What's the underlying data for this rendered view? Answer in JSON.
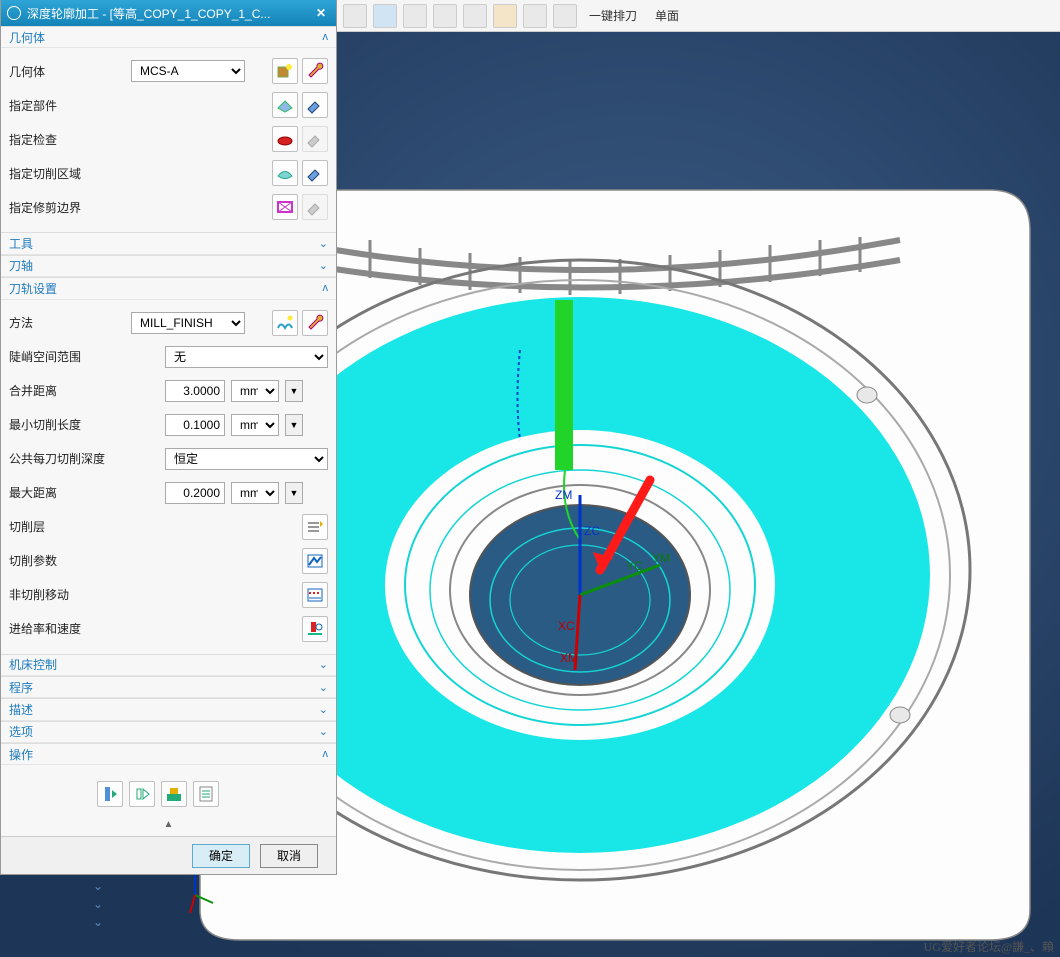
{
  "dialog": {
    "title": "深度轮廓加工 - [等高_COPY_1_COPY_1_C...",
    "close": "✕"
  },
  "top_toolbar": {
    "item1": "一键排刀",
    "item2": "单面"
  },
  "sections": {
    "geometry": {
      "header": "几何体",
      "expanded": true,
      "fields": {
        "geometry_label": "几何体",
        "geometry_value": "MCS-A",
        "specify_part": "指定部件",
        "specify_check": "指定检查",
        "specify_cut_area": "指定切削区域",
        "specify_trim_boundary": "指定修剪边界"
      }
    },
    "tool": {
      "header": "工具",
      "expanded": false
    },
    "tool_axis": {
      "header": "刀轴",
      "expanded": false
    },
    "path_settings": {
      "header": "刀轨设置",
      "expanded": true,
      "fields": {
        "method_label": "方法",
        "method_value": "MILL_FINISH",
        "steep_label": "陡峭空间范围",
        "steep_value": "无",
        "merge_dist_label": "合并距离",
        "merge_dist_value": "3.0000",
        "merge_dist_unit": "mm",
        "min_cut_len_label": "最小切削长度",
        "min_cut_len_value": "0.1000",
        "min_cut_len_unit": "mm",
        "common_depth_label": "公共每刀切削深度",
        "common_depth_value": "恒定",
        "max_dist_label": "最大距离",
        "max_dist_value": "0.2000",
        "max_dist_unit": "mm",
        "cut_levels": "切削层",
        "cut_params": "切削参数",
        "non_cutting": "非切削移动",
        "feeds_speeds": "进给率和速度"
      }
    },
    "machine_control": {
      "header": "机床控制",
      "expanded": false
    },
    "program": {
      "header": "程序",
      "expanded": false
    },
    "description": {
      "header": "描述",
      "expanded": false
    },
    "options": {
      "header": "选项",
      "expanded": false
    },
    "operation": {
      "header": "操作",
      "expanded": true
    }
  },
  "footer": {
    "ok": "确定",
    "cancel": "取消"
  },
  "viewport": {
    "axis_labels": {
      "zm": "ZM",
      "zc": "ZC",
      "yc": "YC",
      "ym": "YM",
      "xc": "XC",
      "xm": "XM"
    }
  },
  "watermark": "UG爱好者论坛@謙_、賴"
}
